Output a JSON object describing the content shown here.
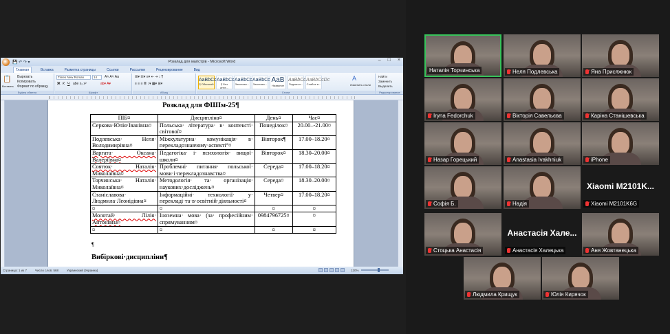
{
  "word": {
    "title": "Розклад для магістрів - Microsoft Word",
    "tabs": [
      "Главная",
      "Вставка",
      "Разметка страницы",
      "Ссылки",
      "Рассылки",
      "Рецензирование",
      "Вид"
    ],
    "active_tab": "Главная",
    "clipboard": {
      "paste": "Вставить",
      "cut": "Вырезать",
      "copy": "Копировать",
      "format": "Формат по образцу",
      "group": "Буфер обмена"
    },
    "font": {
      "name": "Times New Roman",
      "size": "14",
      "group": "Шрифт"
    },
    "paragraph_group": "Абзац",
    "styles_group": "Стили",
    "edit_group": "Редактирование",
    "styles": [
      {
        "preview": "AaBbCcDc",
        "label": "¶ Обычный"
      },
      {
        "preview": "AaBbCcDc",
        "label": "¶ Без инте..."
      },
      {
        "preview": "AaBbCc",
        "label": "Заголово..."
      },
      {
        "preview": "AaBbCc",
        "label": "Заголово..."
      },
      {
        "preview": "AaB",
        "label": "Название"
      },
      {
        "preview": "AaBbCc.",
        "label": "Подзагол..."
      },
      {
        "preview": "AaBbCcDc",
        "label": "Слабое в..."
      }
    ],
    "change_styles": "Изменить стили",
    "edit": {
      "find": "Найти",
      "replace": "Заменить",
      "select": "Выделить"
    },
    "doc_title": "Розклад для ФШІм-25¶",
    "table": {
      "headers": [
        "ПІБ¤",
        "Дисципліна¤",
        "День¤",
        "Час¤"
      ],
      "rows": [
        {
          "name": "Серкова·Юлія·Іванівна¤",
          "course": "Польська· література· в· контексті· світової¤",
          "day": "Понеділок¤",
          "time": "20.00–-21.00¤",
          "ul": false
        },
        {
          "name": "Подлевська· Неля· Володимирівна¤",
          "course": "Міжкультурна· комунікація· в· перекладознавчому·аспекті°¤",
          "day": "Вівторок¶",
          "time": "17.00–18.20¤",
          "ul": false
        },
        {
          "name": "Варгата· Оксана· Валеріївна¤",
          "course": "Педагогіка· і· психологія· вищої· школи¤",
          "day": "Вівторок¤",
          "time": "18.30–20.00¤",
          "ul": true
        },
        {
          "name": "Соятюк· Наталія· Миколаївна¤",
          "course": "Проблемні· питання· польської· мови·і·перекладознавства¤",
          "day": "Середа¤",
          "time": "17.00–18.20¤",
          "ul": true
        },
        {
          "name": "Торчинська· Наталія· Миколаївна¤",
          "course": "Методологія· та· організація· наукових·досліджень¤",
          "day": "Середа¤",
          "time": "18.30–20.00¤",
          "ul": false
        },
        {
          "name": "Станіславова· Людмила·Леонідівна¤",
          "course": "Інформаційні· технології· у· перекладі·та·в·освітній·діяльності¤",
          "day": "Четвер¤",
          "time": "17.00–18.20¤",
          "ul": false
        },
        {
          "name": "¤",
          "course": "¤",
          "day": "¤",
          "time": "¤",
          "ul": false
        },
        {
          "name": "Молотай· Лілія· Антонівна¤",
          "course": "Іноземна· мова· (за· професійним· спрямуванням¤",
          "day": "0984796725¤",
          "time": "¤",
          "ul": true
        },
        {
          "name": "¤",
          "course": "¤",
          "day": "¤",
          "time": "¤",
          "ul": false
        }
      ]
    },
    "pilcrow": "¶",
    "subtitle": "Вибіркові·дисципліни¶",
    "status": {
      "page": "Страница: 1 из 7",
      "words": "Число слов: 568",
      "lang": "Украинский (Украина)",
      "zoom": "120%"
    }
  },
  "participants": [
    {
      "name": "Наталія Торчинська",
      "highlight": true,
      "video": true,
      "muted": false
    },
    {
      "name": "Неля Подлевська",
      "video": true,
      "muted": true
    },
    {
      "name": "Яна Присяжнюк",
      "video": true,
      "muted": true
    },
    {
      "name": "Iryna Fedorchuk",
      "video": true,
      "muted": true
    },
    {
      "name": "Вікторія Савельєва",
      "video": true,
      "muted": true
    },
    {
      "name": "Каріна Станішевська",
      "video": true,
      "muted": true
    },
    {
      "name": "Назар Горецький",
      "video": true,
      "muted": true
    },
    {
      "name": "Anastasia Ivakhniuk",
      "video": true,
      "muted": true
    },
    {
      "name": "iPhone",
      "video": true,
      "muted": true
    },
    {
      "name": "Софія Б.",
      "video": true,
      "muted": true
    },
    {
      "name": "Надія",
      "video": true,
      "muted": true
    },
    {
      "name": "Xiaomi M2101K6G",
      "video": false,
      "muted": true,
      "big": "Xiaomi  M2101K..."
    },
    {
      "name": "Стоцька Анастасія",
      "video": true,
      "muted": true
    },
    {
      "name": "Анастасія Халецька",
      "video": false,
      "muted": true,
      "big": "Анастасія  Хале..."
    },
    {
      "name": "Аня Жовтанецька",
      "video": true,
      "muted": true
    },
    {
      "name": "Людмила Крищук",
      "video": true,
      "muted": true
    },
    {
      "name": "Юлія Кирячок",
      "video": true,
      "muted": true
    }
  ],
  "colors": {
    "active_speaker": "#37c35a",
    "muted_icon": "#e33333",
    "zoom_bg": "#1a1a1a"
  }
}
